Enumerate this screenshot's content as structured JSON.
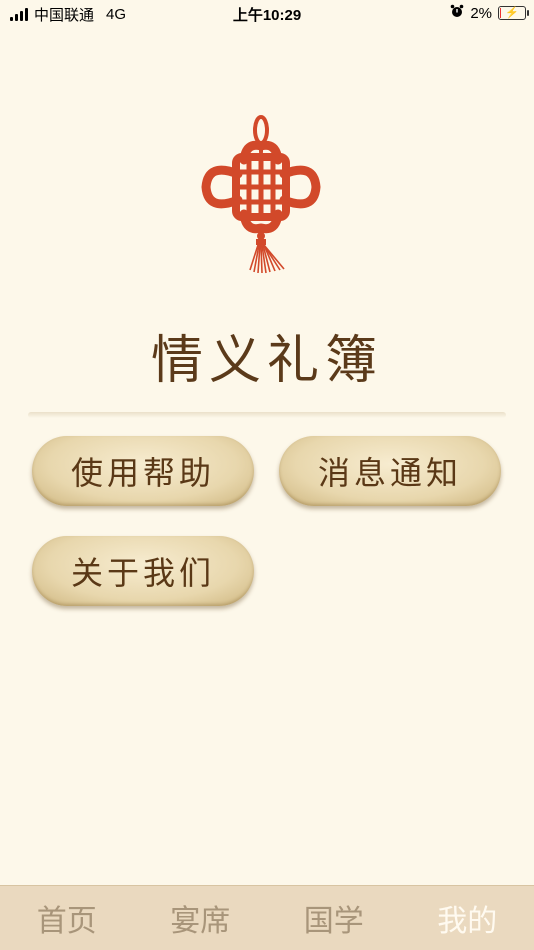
{
  "status_bar": {
    "carrier": "中国联通",
    "network": "4G",
    "time": "上午10:29",
    "battery_percent": "2%",
    "battery_level": 0.02
  },
  "app": {
    "title": "情义礼簿",
    "logo_icon": "chinese-knot-icon",
    "logo_color": "#d2492a"
  },
  "menu": {
    "help_label": "使用帮助",
    "notifications_label": "消息通知",
    "about_label": "关于我们"
  },
  "tabs": [
    {
      "label": "首页",
      "active": false
    },
    {
      "label": "宴席",
      "active": false
    },
    {
      "label": "国学",
      "active": false
    },
    {
      "label": "我的",
      "active": true
    }
  ],
  "colors": {
    "background": "#fdf8ea",
    "title_text": "#5b3a1a",
    "tab_bar": "#ead9bf",
    "tab_inactive": "#a8957a",
    "tab_active": "#fffaf0"
  }
}
